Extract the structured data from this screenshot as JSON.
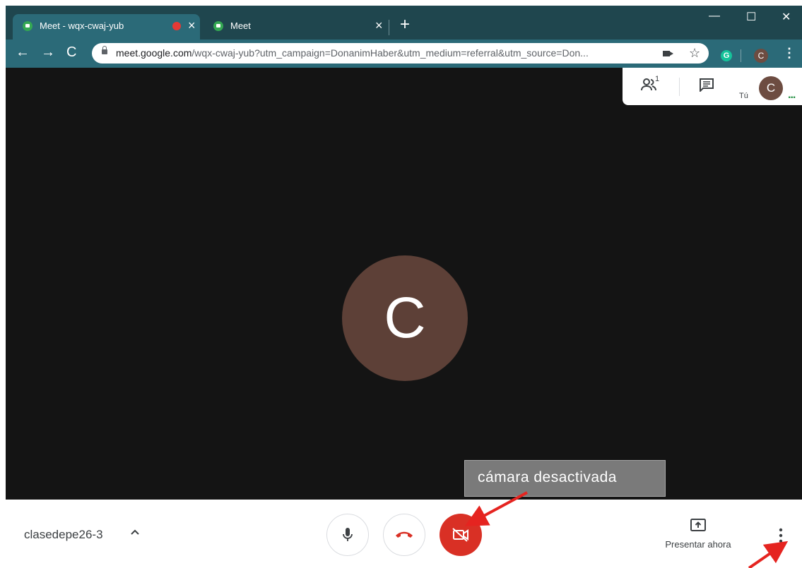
{
  "browser": {
    "tabs": [
      {
        "title": "Meet - wqx-cwaj-yub",
        "active": true,
        "recording": true,
        "close": "×"
      },
      {
        "title": "Meet",
        "active": false,
        "close": "×"
      }
    ],
    "new_tab": "+",
    "window_controls": {
      "minimize": "—",
      "maximize": "☐",
      "close": "✕"
    },
    "nav": {
      "back": "←",
      "forward": "→",
      "reload": "C"
    },
    "url": {
      "host": "meet.google.com",
      "path": "/wqx-cwaj-yub?utm_campaign=DonanimHaber&utm_medium=referral&utm_source=Don..."
    },
    "star": "☆",
    "extension_initial": "G",
    "profile_initial": "C",
    "menu": "⋮"
  },
  "meeting": {
    "participant_initial": "C",
    "participant_count": "1",
    "you_label": "Tú",
    "you_initial": "C",
    "more_dots": "...",
    "annotation": "cámara desactivada",
    "code": "clasedepe26-3",
    "present_label": "Presentar ahora"
  },
  "colors": {
    "tab_strip": "#1f464e",
    "toolbar": "#2b6a78",
    "stage": "#141414",
    "avatar": "#5d4037",
    "camera_off_button": "#d93025",
    "annotation_box": "#7a7a7a",
    "arrow": "#e52420"
  },
  "icons": [
    "people-icon",
    "chat-icon",
    "mic-icon",
    "hangup-icon",
    "camera-off-icon",
    "present-icon",
    "more-vertical-icon",
    "chevron-up-icon"
  ]
}
